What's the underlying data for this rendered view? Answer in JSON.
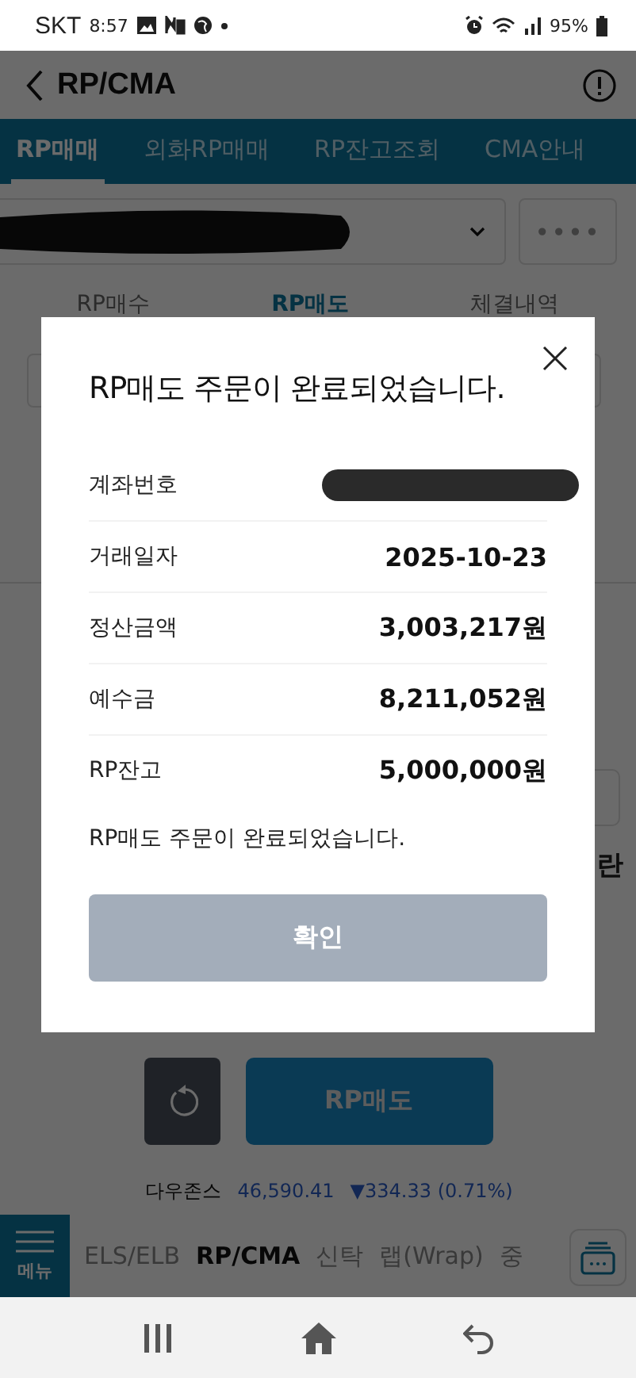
{
  "status_bar": {
    "carrier": "SKT",
    "time": "8:57",
    "battery": "95%"
  },
  "header": {
    "title": "RP/CMA"
  },
  "tabs": [
    {
      "label": "RP매매",
      "selected": true
    },
    {
      "label": "외화RP매매",
      "selected": false
    },
    {
      "label": "RP잔고조회",
      "selected": false
    },
    {
      "label": "CMA안내",
      "selected": false
    }
  ],
  "account": {
    "password_mask": "••••"
  },
  "sub_tabs": [
    {
      "label": "RP매수",
      "selected": false
    },
    {
      "label": "RP매도",
      "selected": true
    },
    {
      "label": "체결내역",
      "selected": false
    }
  ],
  "form_fragment_right": "란",
  "actions": {
    "submit": "RP매도"
  },
  "ticker": {
    "name": "다우존스",
    "value": "46,590.41",
    "change": "▼334.33 (0.71%)"
  },
  "bottom_nav": {
    "menu": "메뉴",
    "items": [
      {
        "label": "ELS/ELB",
        "selected": false
      },
      {
        "label": "RP/CMA",
        "selected": true
      },
      {
        "label": "신탁",
        "selected": false
      },
      {
        "label": "랩(Wrap)",
        "selected": false
      },
      {
        "label": "중",
        "selected": false
      }
    ]
  },
  "dialog": {
    "title": "RP매도 주문이 완료되었습니다.",
    "rows": [
      {
        "label": "계좌번호",
        "kind": "redacted"
      },
      {
        "label": "거래일자",
        "kind": "text",
        "value": "2025-10-23"
      },
      {
        "label": "정산금액",
        "kind": "text",
        "value": "3,003,217원"
      },
      {
        "label": "예수금",
        "kind": "text",
        "value": "8,211,052원"
      },
      {
        "label": "RP잔고",
        "kind": "text",
        "value": "5,000,000원"
      }
    ],
    "message": "RP매도 주문이 완료되었습니다.",
    "confirm": "확인"
  }
}
